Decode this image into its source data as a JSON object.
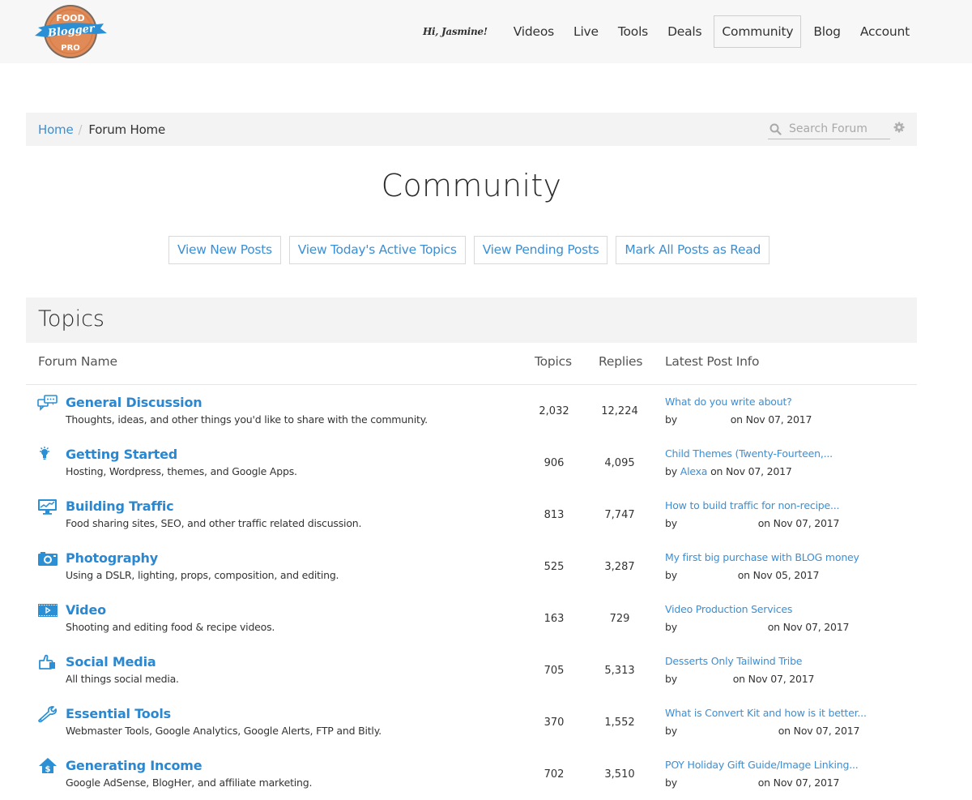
{
  "header": {
    "logo": {
      "line1": "FOOD",
      "line2": "Blogger",
      "line3": "PRO",
      "colors": {
        "badge": "#e08b57",
        "ribbon": "#2a8fd4"
      }
    },
    "greeting": "Hi, Jasmine!",
    "nav": [
      {
        "label": "Videos",
        "active": false
      },
      {
        "label": "Live",
        "active": false
      },
      {
        "label": "Tools",
        "active": false
      },
      {
        "label": "Deals",
        "active": false
      },
      {
        "label": "Community",
        "active": true
      },
      {
        "label": "Blog",
        "active": false
      },
      {
        "label": "Account",
        "active": false
      }
    ]
  },
  "breadcrumb": {
    "home": "Home",
    "separator": "/",
    "current": "Forum Home"
  },
  "search": {
    "placeholder": "Search Forum",
    "value": ""
  },
  "page_title": "Community",
  "actions": [
    "View New Posts",
    "View Today's Active Topics",
    "View Pending Posts",
    "Mark All Posts as Read"
  ],
  "topics": {
    "heading": "Topics",
    "columns": {
      "name": "Forum Name",
      "topics": "Topics",
      "replies": "Replies",
      "latest": "Latest Post Info"
    },
    "forums": [
      {
        "icon": "chat-bubbles-icon",
        "name": "General Discussion",
        "description": "Thoughts, ideas, and other things you'd like to share with the community.",
        "topics": "2,032",
        "replies": "12,224",
        "latest_title": "What do you write about?",
        "by": "by",
        "author": "",
        "date": "on Nov 07, 2017",
        "gap": 62
      },
      {
        "icon": "lightbulb-icon",
        "name": "Getting Started",
        "description": "Hosting, Wordpress, themes, and Google Apps.",
        "topics": "906",
        "replies": "4,095",
        "latest_title": "Child Themes (Twenty-Fourteen,...",
        "by": "by",
        "author": "Alexa",
        "date": "on Nov 07, 2017",
        "gap": 0
      },
      {
        "icon": "monitor-chart-icon",
        "name": "Building Traffic",
        "description": "Food sharing sites, SEO, and other traffic related discussion.",
        "topics": "813",
        "replies": "7,747",
        "latest_title": "How to build traffic for non-recipe...",
        "by": "by",
        "author": "",
        "date": "on Nov 07, 2017",
        "gap": 96
      },
      {
        "icon": "camera-icon",
        "name": "Photography",
        "description": "Using a DSLR, lighting, props, composition, and editing.",
        "topics": "525",
        "replies": "3,287",
        "latest_title": "My first big purchase with BLOG money",
        "by": "by",
        "author": "",
        "date": "on Nov 05, 2017",
        "gap": 71
      },
      {
        "icon": "film-play-icon",
        "name": "Video",
        "description": "Shooting and editing food & recipe videos.",
        "topics": "163",
        "replies": "729",
        "latest_title": "Video Production Services",
        "by": "by",
        "author": "",
        "date": "on Nov 07, 2017",
        "gap": 108
      },
      {
        "icon": "thumbs-up-icon",
        "name": "Social Media",
        "description": "All things social media.",
        "topics": "705",
        "replies": "5,313",
        "latest_title": "Desserts Only Tailwind Tribe",
        "by": "by",
        "author": "",
        "date": "on Nov 07, 2017",
        "gap": 65
      },
      {
        "icon": "wrench-icon",
        "name": "Essential Tools",
        "description": "Webmaster Tools, Google Analytics, Google Alerts, FTP and Bitly.",
        "topics": "370",
        "replies": "1,552",
        "latest_title": "What is Convert Kit and how is it better...",
        "by": "by",
        "author": "",
        "date": "on Nov 07, 2017",
        "gap": 121
      },
      {
        "icon": "house-dollar-icon",
        "name": "Generating Income",
        "description": "Google AdSense, BlogHer, and affiliate marketing.",
        "topics": "702",
        "replies": "3,510",
        "latest_title": "POY Holiday Gift Guide/Image Linking...",
        "by": "by",
        "author": "",
        "date": "on Nov 07, 2017",
        "gap": 96
      }
    ]
  },
  "colors": {
    "link": "#3a8fd6",
    "forum_title": "#2a87d0",
    "header_bg": "#f7f7f7",
    "panel_bg": "#f3f3f3",
    "icon": "#2a8fd4"
  }
}
